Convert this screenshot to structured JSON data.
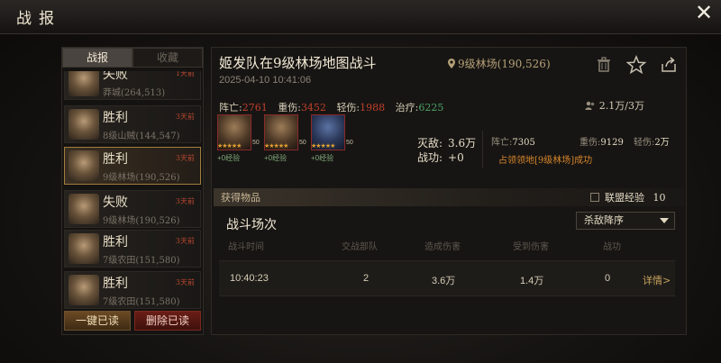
{
  "header": {
    "title": "战报",
    "close_glyph": "✕"
  },
  "left": {
    "tabs": [
      {
        "label": "战报",
        "active": true
      },
      {
        "label": "收藏",
        "active": false
      }
    ],
    "reports": [
      {
        "result": "失败",
        "location": "莽城(264,513)",
        "time": "1天前",
        "selected": false
      },
      {
        "result": "胜利",
        "location": "8级山贼(144,547)",
        "time": "3天前",
        "selected": false
      },
      {
        "result": "胜利",
        "location": "9级林场(190,526)",
        "time": "3天前",
        "selected": true
      },
      {
        "result": "失败",
        "location": "9级林场(190,526)",
        "time": "3天前",
        "selected": false
      },
      {
        "result": "胜利",
        "location": "7级农田(151,580)",
        "time": "3天前",
        "selected": false
      },
      {
        "result": "胜利",
        "location": "7级农田(151,580)",
        "time": "3天前",
        "selected": false
      }
    ],
    "mark_read_label": "一键已读",
    "delete_read_label": "删除已读"
  },
  "detail": {
    "title": "姬发队在9级林场地图战斗",
    "location": "9级林场(190,526)",
    "datetime": "2025-04-10 10:41:06",
    "stats": {
      "dead_label": "阵亡:",
      "dead": "2761",
      "heavy_label": "重伤:",
      "heavy": "3452",
      "light_label": "轻伤:",
      "light": "1988",
      "heal_label": "治疗:",
      "heal": "6225"
    },
    "troops": "2.1万/3万",
    "heroes": [
      {
        "stars": "★★★★★",
        "level": "50",
        "exp": "+0经验"
      },
      {
        "stars": "★★★★★",
        "level": "50",
        "exp": "+0经验"
      },
      {
        "stars": "★★★★★",
        "level": "50",
        "exp": "+0经验"
      }
    ],
    "kills_label": "灭敌:",
    "kills": "3.6万",
    "merit_label": "战功:",
    "merit": "+0",
    "enemy": {
      "dead_label": "阵亡:",
      "dead": "7305",
      "heavy_label": "重伤:",
      "heavy": "9129",
      "light_label": "轻伤:",
      "light": "2万"
    },
    "occupy_text": "占领领地[9级林场]成功",
    "items_label": "获得物品",
    "alliance_exp_label": "联盟经验",
    "alliance_exp": "10",
    "rounds_title": "战斗场次",
    "sort_option": "杀敌降序",
    "columns": [
      "战斗时间",
      "交战部队",
      "造成伤害",
      "受到伤害",
      "战功"
    ],
    "rows": [
      {
        "time": "10:40:23",
        "units": "2",
        "dealt": "3.6万",
        "taken": "1.4万",
        "merit": "0",
        "link": "详情>"
      }
    ]
  },
  "colors": {
    "loss_red": "#c0402c",
    "heal_green": "#4da366",
    "accent_gold": "#a37d3d",
    "occupy_orange": "#d6862c"
  },
  "icons": [
    "close-icon",
    "location-pin-icon",
    "trash-icon",
    "star-icon",
    "share-icon",
    "troops-icon",
    "alliance-exp-icon",
    "dropdown-arrow-icon"
  ]
}
